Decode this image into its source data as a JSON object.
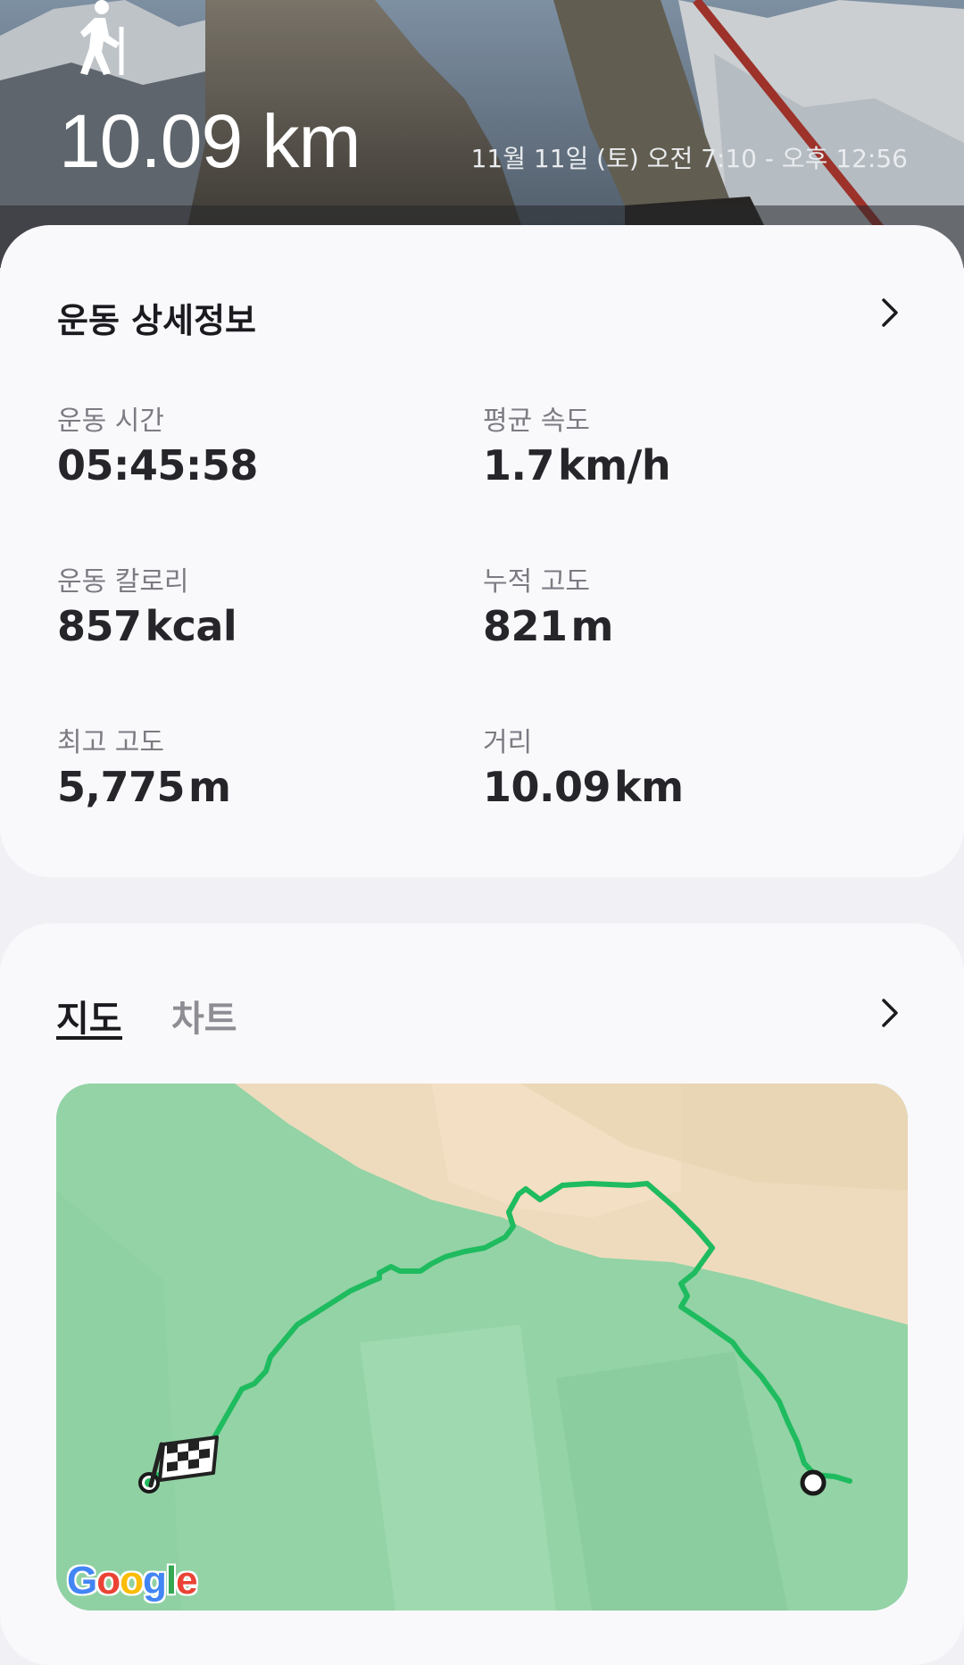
{
  "header": {
    "activity_icon": "hiking-person-icon",
    "distance": "10.09 km",
    "time_range": "11월 11일 (토) 오전 7:10 - 오후 12:56"
  },
  "details": {
    "title": "운동 상세정보",
    "chevron_icon": "chevron-right-icon",
    "stats": [
      {
        "label": "운동 시간",
        "value": "05:45:58",
        "unit": ""
      },
      {
        "label": "평균 속도",
        "value": "1.7",
        "unit": "km/h"
      },
      {
        "label": "운동 칼로리",
        "value": "857",
        "unit": "kcal"
      },
      {
        "label": "누적 고도",
        "value": "821",
        "unit": "m"
      },
      {
        "label": "최고 고도",
        "value": "5,775",
        "unit": "m"
      },
      {
        "label": "거리",
        "value": "10.09",
        "unit": "km"
      }
    ]
  },
  "map_section": {
    "tabs": [
      {
        "label": "지도",
        "selected": true
      },
      {
        "label": "차트",
        "selected": false
      }
    ],
    "chevron_icon": "chevron-right-icon",
    "map_attribution": [
      "G",
      "o",
      "o",
      "g",
      "l",
      "e"
    ],
    "route_color": "#1fbb5f",
    "start_marker_icon": "start-point-icon",
    "finish_marker_icon": "checkered-flag-icon",
    "end_marker_icon": "end-point-icon"
  },
  "colors": {
    "accent_green": "#1fbb5f",
    "text_primary": "#1b1b1f",
    "text_secondary": "#7b7b82"
  }
}
